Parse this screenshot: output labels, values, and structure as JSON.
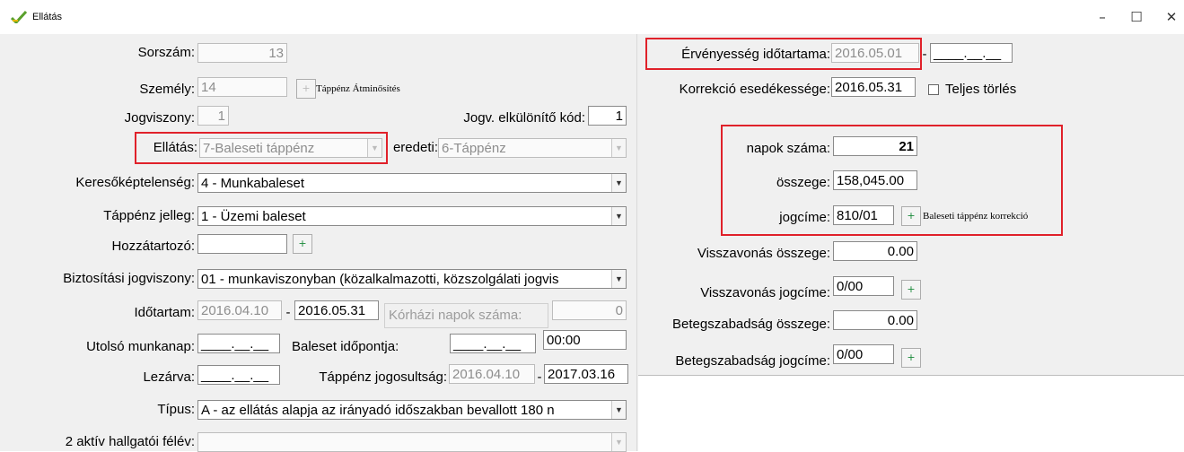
{
  "window": {
    "title": "Ellátás",
    "minimize": "–",
    "maximize": "☐",
    "close": "✕"
  },
  "left": {
    "sorszam": {
      "label": "Sorszám:",
      "value": "13"
    },
    "szemely": {
      "label": "Személy:",
      "value": "14",
      "link": "Táppénz Átminősítés"
    },
    "jogviszony": {
      "label": "Jogviszony:",
      "value": "1"
    },
    "jogv_kod": {
      "label": "Jogv. elkülönítő kód:",
      "value": "1"
    },
    "ellatas": {
      "label": "Ellátás:",
      "value": "7-Baleseti táppénz"
    },
    "eredeti": {
      "label": "eredeti:",
      "value": "6-Táppénz"
    },
    "kereso": {
      "label": "Keresőképtelenség:",
      "value": "4 - Munkabaleset"
    },
    "tappenz_jelleg": {
      "label": "Táppénz jelleg:",
      "value": "1 - Üzemi baleset"
    },
    "hozzatartozo": {
      "label": "Hozzátartozó:",
      "value": ""
    },
    "biztositasi": {
      "label": "Biztosítási jogviszony:",
      "value": "01 - munkaviszonyban (közalkalmazotti, közszolgálati jogvis"
    },
    "idotartam": {
      "label": "Időtartam:",
      "from": "2016.04.10",
      "sep": "-",
      "to": "2016.05.31"
    },
    "korhazi": {
      "label": "Kórházi napok száma:",
      "value": "0"
    },
    "utolso": {
      "label": "Utolsó munkanap:",
      "value": "____.__.__"
    },
    "baleset_idopont": {
      "label": "Baleset időpontja:",
      "date": "____.__.__",
      "time": "00:00"
    },
    "lezarva": {
      "label": "Lezárva:",
      "value": "____.__.__"
    },
    "jogosultsag": {
      "label": "Táppénz jogosultság:",
      "from": "2016.04.10",
      "sep": "-",
      "to": "2017.03.16"
    },
    "tipus": {
      "label": "Típus:",
      "value": "A - az ellátás alapja az irányadó időszakban bevallott 180 n"
    },
    "hallgatoi": {
      "label": "2 aktív hallgatói félév:",
      "value": ""
    }
  },
  "right": {
    "ervenyesseg": {
      "label": "Érvényesség időtartama:",
      "from": "2016.05.01",
      "sep": "-",
      "to": "____.__.__"
    },
    "korrekcio": {
      "label": "Korrekció esedékessége:",
      "value": "2016.05.31"
    },
    "teljes_torles": {
      "label": "Teljes törlés"
    },
    "napok": {
      "label": "napok száma:",
      "value": "21"
    },
    "osszege": {
      "label": "összege:",
      "value": "158,045.00"
    },
    "jogcime": {
      "label": "jogcíme:",
      "value": "810/01",
      "link": "Baleseti táppénz korrekció"
    },
    "visszavonas_osszeg": {
      "label": "Visszavonás összege:",
      "value": "0.00"
    },
    "visszavonas_jogcim": {
      "label": "Visszavonás jogcíme:",
      "value": "0/00"
    },
    "betegszab_osszeg": {
      "label": "Betegszabadság összege:",
      "value": "0.00"
    },
    "betegszab_jogcim": {
      "label": "Betegszabadság jogcíme:",
      "value": "0/00"
    }
  },
  "icons": {
    "plus_button": "plus-icon",
    "dropdown": "chevron-down-icon",
    "app": "app-logo-icon"
  },
  "colors": {
    "highlight": "#e0212a",
    "plus": "#1a8a3a"
  }
}
